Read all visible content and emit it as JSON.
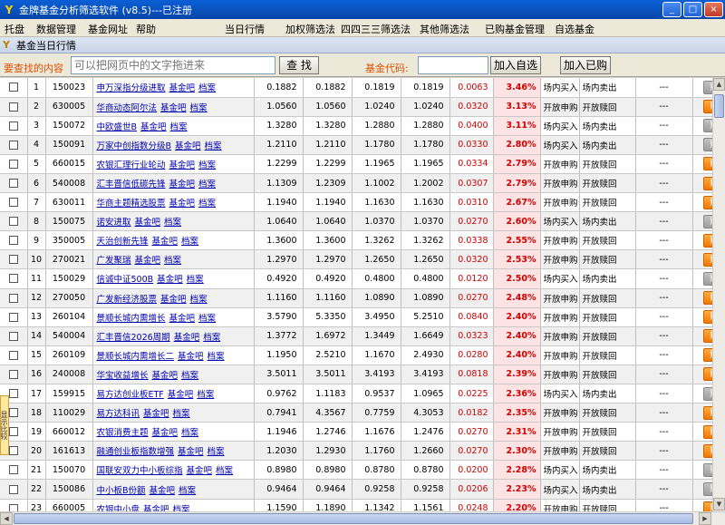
{
  "window": {
    "title": "金牌基金分析筛选软件 (v8.5)---已注册",
    "minimize_glyph": "_",
    "maximize_glyph": "□",
    "close_glyph": "×",
    "icon": "fund-logo-icon"
  },
  "menu": {
    "items": [
      "托盘",
      "数据管理",
      "基金网址",
      "帮助",
      "当日行情",
      "加权筛选法",
      "四四三三筛选法",
      "其他筛选法",
      "已购基金管理",
      "自选基金"
    ]
  },
  "panel": {
    "title": "基金当日行情"
  },
  "search": {
    "label": "要查找的内容",
    "placeholder": "可以把网页中的文字拖进来",
    "find_button": "查 找",
    "code_label": "基金代码:",
    "add_watch_button": "加入自选",
    "add_bought_button": "加入已购"
  },
  "side_tab": {
    "label": "显示比较"
  },
  "table": {
    "link_jijinba": "基金吧",
    "link_dangan": "档案",
    "dash": "---",
    "buy_label": "购买",
    "buy_caret": "▼",
    "rows": [
      {
        "idx": "1",
        "code": "150023",
        "name": "申万深指分级进取",
        "v1": "0.1882",
        "v2": "0.1882",
        "v3": "0.1819",
        "v4": "0.1819",
        "chg": "0.0063",
        "pct": "3.46%",
        "buy_status": "场内买入",
        "sell_status": "场内卖出",
        "buy_active": false
      },
      {
        "idx": "2",
        "code": "630005",
        "name": "华商动态阿尔法",
        "v1": "1.0560",
        "v2": "1.0560",
        "v3": "1.0240",
        "v4": "1.0240",
        "chg": "0.0320",
        "pct": "3.13%",
        "buy_status": "开放申购",
        "sell_status": "开放赎回",
        "buy_active": true
      },
      {
        "idx": "3",
        "code": "150072",
        "name": "中欧盛世B",
        "v1": "1.3280",
        "v2": "1.3280",
        "v3": "1.2880",
        "v4": "1.2880",
        "chg": "0.0400",
        "pct": "3.11%",
        "buy_status": "场内买入",
        "sell_status": "场内卖出",
        "buy_active": false
      },
      {
        "idx": "4",
        "code": "150091",
        "name": "万家中创指数分级B",
        "v1": "1.2110",
        "v2": "1.2110",
        "v3": "1.1780",
        "v4": "1.1780",
        "chg": "0.0330",
        "pct": "2.80%",
        "buy_status": "场内买入",
        "sell_status": "场内卖出",
        "buy_active": false
      },
      {
        "idx": "5",
        "code": "660015",
        "name": "农银汇理行业轮动",
        "v1": "1.2299",
        "v2": "1.2299",
        "v3": "1.1965",
        "v4": "1.1965",
        "chg": "0.0334",
        "pct": "2.79%",
        "buy_status": "开放申购",
        "sell_status": "开放赎回",
        "buy_active": true
      },
      {
        "idx": "6",
        "code": "540008",
        "name": "汇丰晋信低碳先锋",
        "v1": "1.1309",
        "v2": "1.2309",
        "v3": "1.1002",
        "v4": "1.2002",
        "chg": "0.0307",
        "pct": "2.79%",
        "buy_status": "开放申购",
        "sell_status": "开放赎回",
        "buy_active": true
      },
      {
        "idx": "7",
        "code": "630011",
        "name": "华商主题精选股票",
        "v1": "1.1940",
        "v2": "1.1940",
        "v3": "1.1630",
        "v4": "1.1630",
        "chg": "0.0310",
        "pct": "2.67%",
        "buy_status": "开放申购",
        "sell_status": "开放赎回",
        "buy_active": true
      },
      {
        "idx": "8",
        "code": "150075",
        "name": "诺安进取",
        "v1": "1.0640",
        "v2": "1.0640",
        "v3": "1.0370",
        "v4": "1.0370",
        "chg": "0.0270",
        "pct": "2.60%",
        "buy_status": "场内买入",
        "sell_status": "场内卖出",
        "buy_active": false
      },
      {
        "idx": "9",
        "code": "350005",
        "name": "天治创新先锋",
        "v1": "1.3600",
        "v2": "1.3600",
        "v3": "1.3262",
        "v4": "1.3262",
        "chg": "0.0338",
        "pct": "2.55%",
        "buy_status": "开放申购",
        "sell_status": "开放赎回",
        "buy_active": true
      },
      {
        "idx": "10",
        "code": "270021",
        "name": "广发聚瑞",
        "v1": "1.2970",
        "v2": "1.2970",
        "v3": "1.2650",
        "v4": "1.2650",
        "chg": "0.0320",
        "pct": "2.53%",
        "buy_status": "开放申购",
        "sell_status": "开放赎回",
        "buy_active": true
      },
      {
        "idx": "11",
        "code": "150029",
        "name": "信诚中证500B",
        "v1": "0.4920",
        "v2": "0.4920",
        "v3": "0.4800",
        "v4": "0.4800",
        "chg": "0.0120",
        "pct": "2.50%",
        "buy_status": "场内买入",
        "sell_status": "场内卖出",
        "buy_active": false
      },
      {
        "idx": "12",
        "code": "270050",
        "name": "广发新经济股票",
        "v1": "1.1160",
        "v2": "1.1160",
        "v3": "1.0890",
        "v4": "1.0890",
        "chg": "0.0270",
        "pct": "2.48%",
        "buy_status": "开放申购",
        "sell_status": "开放赎回",
        "buy_active": true
      },
      {
        "idx": "13",
        "code": "260104",
        "name": "景顺长城内需增长",
        "v1": "3.5790",
        "v2": "5.3350",
        "v3": "3.4950",
        "v4": "5.2510",
        "chg": "0.0840",
        "pct": "2.40%",
        "buy_status": "开放申购",
        "sell_status": "开放赎回",
        "buy_active": true
      },
      {
        "idx": "14",
        "code": "540004",
        "name": "汇丰晋信2026周期",
        "v1": "1.3772",
        "v2": "1.6972",
        "v3": "1.3449",
        "v4": "1.6649",
        "chg": "0.0323",
        "pct": "2.40%",
        "buy_status": "开放申购",
        "sell_status": "开放赎回",
        "buy_active": true
      },
      {
        "idx": "15",
        "code": "260109",
        "name": "景顺长城内需增长二",
        "v1": "1.1950",
        "v2": "2.5210",
        "v3": "1.1670",
        "v4": "2.4930",
        "chg": "0.0280",
        "pct": "2.40%",
        "buy_status": "开放申购",
        "sell_status": "开放赎回",
        "buy_active": true
      },
      {
        "idx": "16",
        "code": "240008",
        "name": "华宝收益增长",
        "v1": "3.5011",
        "v2": "3.5011",
        "v3": "3.4193",
        "v4": "3.4193",
        "chg": "0.0818",
        "pct": "2.39%",
        "buy_status": "开放申购",
        "sell_status": "开放赎回",
        "buy_active": true
      },
      {
        "idx": "17",
        "code": "159915",
        "name": "易方达创业板ETF",
        "v1": "0.9762",
        "v2": "1.1183",
        "v3": "0.9537",
        "v4": "1.0965",
        "chg": "0.0225",
        "pct": "2.36%",
        "buy_status": "场内买入",
        "sell_status": "场内卖出",
        "buy_active": false
      },
      {
        "idx": "18",
        "code": "110029",
        "name": "易方达科讯",
        "v1": "0.7941",
        "v2": "4.3567",
        "v3": "0.7759",
        "v4": "4.3053",
        "chg": "0.0182",
        "pct": "2.35%",
        "buy_status": "开放申购",
        "sell_status": "开放赎回",
        "buy_active": true
      },
      {
        "idx": "19",
        "code": "660012",
        "name": "农银消费主题",
        "v1": "1.1946",
        "v2": "1.2746",
        "v3": "1.1676",
        "v4": "1.2476",
        "chg": "0.0270",
        "pct": "2.31%",
        "buy_status": "开放申购",
        "sell_status": "开放赎回",
        "buy_active": true
      },
      {
        "idx": "20",
        "code": "161613",
        "name": "融通创业板指数增强",
        "v1": "1.2030",
        "v2": "1.2930",
        "v3": "1.1760",
        "v4": "1.2660",
        "chg": "0.0270",
        "pct": "2.30%",
        "buy_status": "开放申购",
        "sell_status": "开放赎回",
        "buy_active": true
      },
      {
        "idx": "21",
        "code": "150070",
        "name": "国联安双力中小板综指",
        "v1": "0.8980",
        "v2": "0.8980",
        "v3": "0.8780",
        "v4": "0.8780",
        "chg": "0.0200",
        "pct": "2.28%",
        "buy_status": "场内买入",
        "sell_status": "场内卖出",
        "buy_active": false
      },
      {
        "idx": "22",
        "code": "150086",
        "name": "中小板B份额",
        "v1": "0.9464",
        "v2": "0.9464",
        "v3": "0.9258",
        "v4": "0.9258",
        "chg": "0.0206",
        "pct": "2.23%",
        "buy_status": "场内买入",
        "sell_status": "场内卖出",
        "buy_active": false
      },
      {
        "idx": "23",
        "code": "660005",
        "name": "农银中小盘",
        "v1": "1.1590",
        "v2": "1.1890",
        "v3": "1.1342",
        "v4": "1.1561",
        "chg": "0.0248",
        "pct": "2.20%",
        "buy_status": "开放申购",
        "sell_status": "开放赎回",
        "buy_active": true
      }
    ]
  }
}
